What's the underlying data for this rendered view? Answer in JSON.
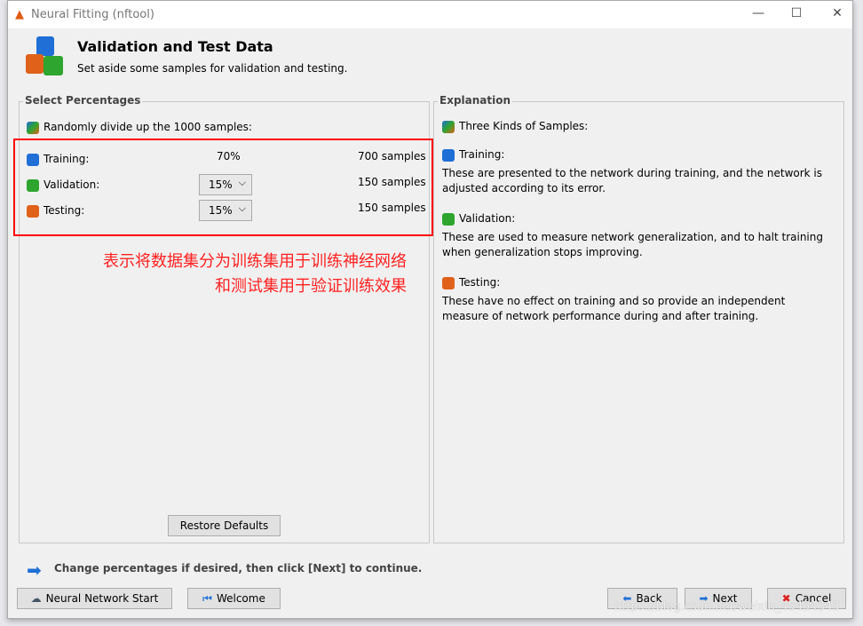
{
  "window": {
    "title": "Neural Fitting (nftool)"
  },
  "header": {
    "title": "Validation and Test Data",
    "subtitle": "Set aside some samples for validation and testing."
  },
  "left": {
    "legend": "Select Percentages",
    "intro": "Randomly divide up the 1000 samples:",
    "rows": [
      {
        "label": "Training:",
        "pct": "70%",
        "samples": "700 samples",
        "color": "#1f6fd6"
      },
      {
        "label": "Validation:",
        "pct": "15%",
        "samples": "150 samples",
        "color": "#2ea52e"
      },
      {
        "label": "Testing:",
        "pct": "15%",
        "samples": "150 samples",
        "color": "#e0621a"
      }
    ],
    "restore": "Restore Defaults"
  },
  "annotation": {
    "line1": "表示将数据集分为训练集用于训练神经网络",
    "line2": "和测试集用于验证训练效果"
  },
  "right": {
    "legend": "Explanation",
    "intro": "Three Kinds of Samples:",
    "items": [
      {
        "title": "Training:",
        "text": "These are presented to the network during training, and the network is adjusted according to its error."
      },
      {
        "title": "Validation:",
        "text": "These are used to measure network generalization, and to halt training when generalization stops improving."
      },
      {
        "title": "Testing:",
        "text": "These have no effect on training and so provide an independent measure of network performance during and after training."
      }
    ]
  },
  "hint": "Change percentages if desired, then click [Next] to continue.",
  "buttons": {
    "start": "Neural Network Start",
    "welcome": "Welcome",
    "back": "Back",
    "next": "Next",
    "cancel": "Cancel"
  },
  "watermark": "https://blog.csdn.net/weixin_45454343"
}
